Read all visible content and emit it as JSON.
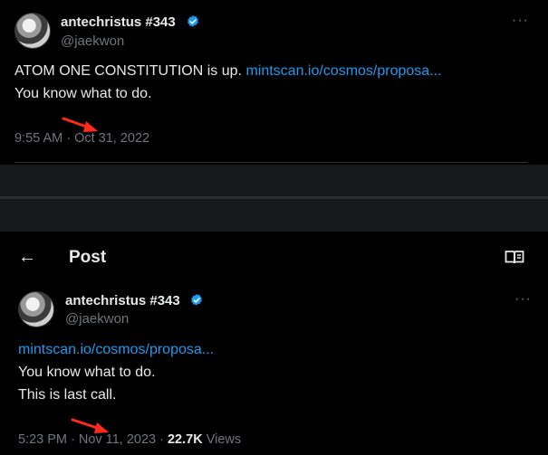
{
  "top_post": {
    "author_name": "antechristus #343",
    "author_handle": "@jaekwon",
    "text_prefix": "ATOM ONE CONSTITUTION is up. ",
    "link": "mintscan.io/cosmos/proposa...",
    "line2": "You know what to do.",
    "time": "9:55 AM",
    "date": "Oct 31, 2022",
    "more_label": "···"
  },
  "bottom_post": {
    "header_title": "Post",
    "back_label": "←",
    "author_name": "antechristus #343",
    "author_handle": "@jaekwon",
    "link": "mintscan.io/cosmos/proposa...",
    "line2": "You know what to do.",
    "line3": "This is last call.",
    "time": "5:23 PM",
    "date": "Nov 11, 2023",
    "views_count": "22.7K",
    "views_label": "Views",
    "more_label": "···"
  },
  "colors": {
    "background": "#000000",
    "text": "#e7e9ea",
    "muted": "#71767b",
    "link": "#1d9bf0",
    "verified": "#1d9bf0",
    "annotation_arrow": "#ff2a1a"
  },
  "icons": [
    "verified-badge-icon",
    "more-options-icon",
    "back-arrow-icon",
    "reader-mode-icon",
    "annotation-arrow-icon"
  ]
}
